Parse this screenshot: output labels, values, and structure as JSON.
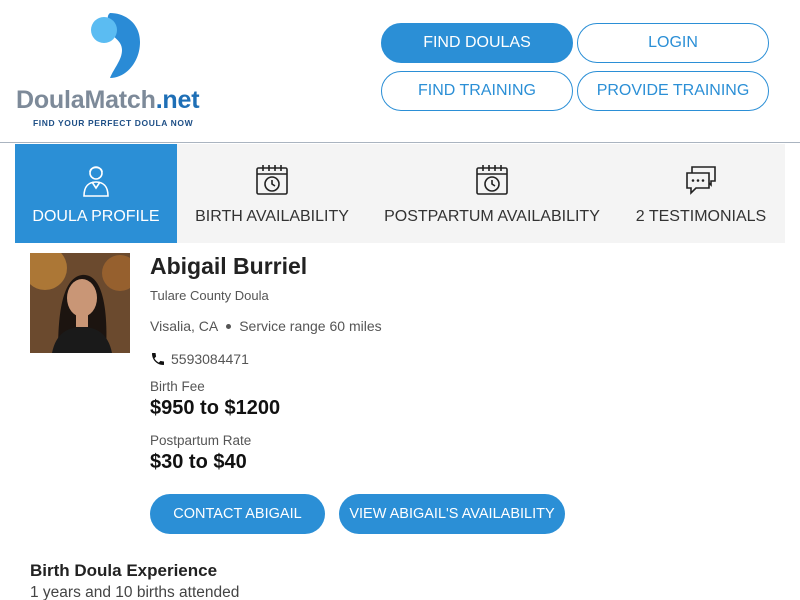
{
  "brand": {
    "name_main": "DoulaMatch",
    "name_suffix": ".net",
    "tagline": "FIND YOUR PERFECT DOULA NOW",
    "colors": {
      "primary": "#2b8fd6",
      "logo_light": "#5bbcf2",
      "logo_dark": "#2a8bd6",
      "text_grey": "#7d8a99"
    }
  },
  "nav": {
    "find_doulas": "FIND DOULAS",
    "login": "LOGIN",
    "find_training": "FIND TRAINING",
    "provide_training": "PROVIDE TRAINING"
  },
  "tabs": [
    {
      "label": "DOULA PROFILE",
      "icon": "person-icon",
      "active": true
    },
    {
      "label": "BIRTH AVAILABILITY",
      "icon": "calendar-clock-icon",
      "active": false
    },
    {
      "label": "POSTPARTUM AVAILABILITY",
      "icon": "calendar-clock-icon",
      "active": false
    },
    {
      "label": "2 TESTIMONIALS",
      "icon": "chat-bubbles-icon",
      "active": false
    }
  ],
  "profile": {
    "name": "Abigail Burriel",
    "subtitle": "Tulare County Doula",
    "location": "Visalia, CA",
    "service_range": "Service range 60 miles",
    "phone": "5593084471",
    "birth_fee_label": "Birth Fee",
    "birth_fee": "$950 to $1200",
    "postpartum_rate_label": "Postpartum Rate",
    "postpartum_rate": "$30 to $40"
  },
  "actions": {
    "contact": "CONTACT ABIGAIL",
    "availability": "VIEW ABIGAIL'S AVAILABILITY"
  },
  "experience": {
    "title": "Birth Doula Experience",
    "text": "1 years and 10 births attended"
  }
}
